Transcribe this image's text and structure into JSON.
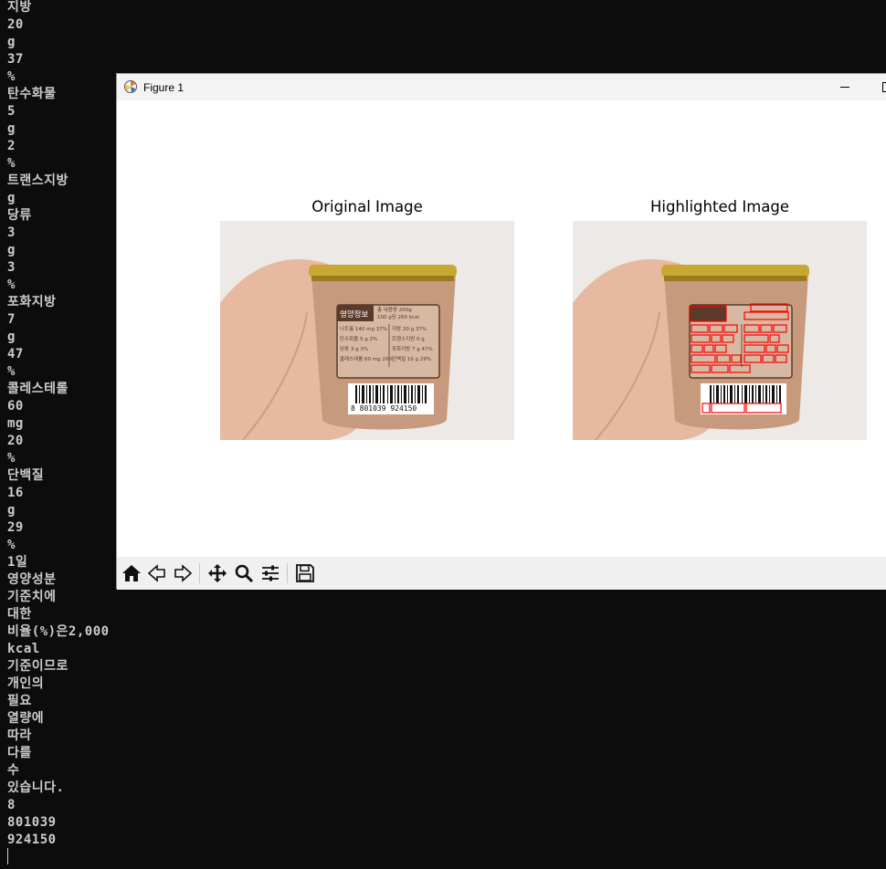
{
  "terminal": {
    "lines": [
      "지방",
      "20",
      "g",
      "37",
      "%",
      "탄수화물",
      "5",
      "g",
      "2",
      "%",
      "트랜스지방",
      "g",
      "당류",
      "3",
      "g",
      "3",
      "%",
      "포화지방",
      "7",
      "g",
      "47",
      "%",
      "콜레스테롤",
      "60",
      "mg",
      "20",
      "%",
      "단백질",
      "16",
      "g",
      "29",
      "%",
      "1일",
      "영양성분",
      "기준치에",
      "대한",
      "비율(%)은2,000",
      "kcal",
      "기준이므로",
      "개인의",
      "필요",
      "열량에",
      "따라",
      "다를",
      "수",
      "있습니다.",
      "8",
      "801039",
      "924150"
    ]
  },
  "figure": {
    "window_title": "Figure 1",
    "left_title": "Original Image",
    "right_title": "Highlighted Image",
    "label_text": {
      "panel_header": "영양정보",
      "serving": "총 내용량 200g",
      "serving2": "100 g당 260 kcal",
      "row1": "나트륨 140 mg 37%",
      "row1b": "지방 20 g 37%",
      "row2": "탄수화물 5 g 2%",
      "row2b": "트랜스지방 0 g",
      "row3": "당류 3 g 3%",
      "row3b": "포화지방 7 g 47%",
      "row4": "콜레스테롤 60 mg 20%",
      "row4b": "단백질 16 g 29%",
      "barcode": "8 801039 924150"
    }
  },
  "toolbar": {
    "buttons": [
      "home-icon",
      "back-icon",
      "forward-icon",
      "pan-icon",
      "zoom-icon",
      "configure-icon",
      "save-icon"
    ]
  },
  "colors": {
    "terminal_bg": "#0c0c0c",
    "terminal_fg": "#cccccc",
    "highlight": "#ff0000",
    "lid_gold": "#c8a832",
    "cup_body": "#c79a7d",
    "label_brown": "#5a3a2a"
  }
}
